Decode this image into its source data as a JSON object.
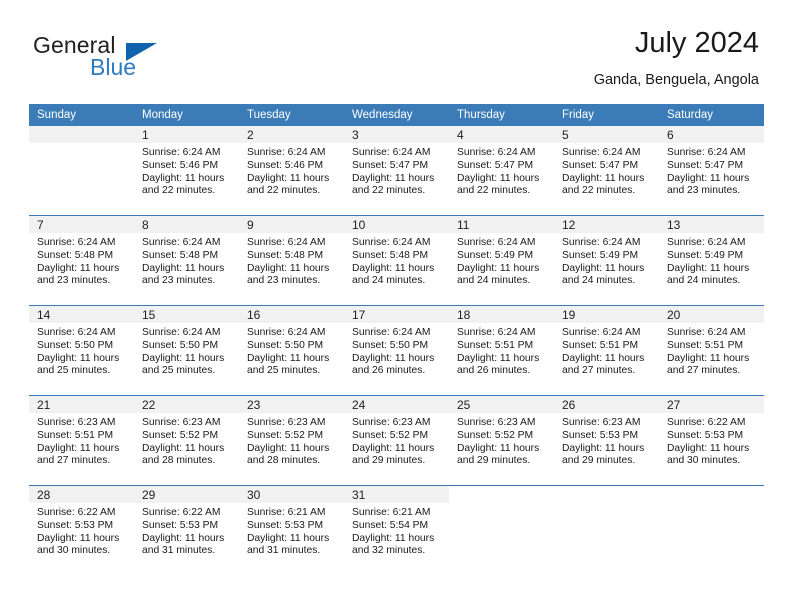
{
  "brand": {
    "name_top": "General",
    "name_bottom": "Blue",
    "accent_color": "#0f62ac",
    "blue_text_color": "#2b7cc4",
    "triangle_icon": "brand-triangle-icon"
  },
  "header": {
    "title": "July 2024",
    "subtitle": "Ganda, Benguela, Angola"
  },
  "calendar": {
    "header_bg": "#3b7cb8",
    "daynum_bg": "#f1f1f1",
    "weekdays": [
      "Sunday",
      "Monday",
      "Tuesday",
      "Wednesday",
      "Thursday",
      "Friday",
      "Saturday"
    ],
    "weeks": [
      [
        {
          "day": "",
          "sunrise": "",
          "sunset": "",
          "daylight": "",
          "daylight2": "",
          "empty": true
        },
        {
          "day": "1",
          "sunrise": "Sunrise: 6:24 AM",
          "sunset": "Sunset: 5:46 PM",
          "daylight": "Daylight: 11 hours",
          "daylight2": "and 22 minutes."
        },
        {
          "day": "2",
          "sunrise": "Sunrise: 6:24 AM",
          "sunset": "Sunset: 5:46 PM",
          "daylight": "Daylight: 11 hours",
          "daylight2": "and 22 minutes."
        },
        {
          "day": "3",
          "sunrise": "Sunrise: 6:24 AM",
          "sunset": "Sunset: 5:47 PM",
          "daylight": "Daylight: 11 hours",
          "daylight2": "and 22 minutes."
        },
        {
          "day": "4",
          "sunrise": "Sunrise: 6:24 AM",
          "sunset": "Sunset: 5:47 PM",
          "daylight": "Daylight: 11 hours",
          "daylight2": "and 22 minutes."
        },
        {
          "day": "5",
          "sunrise": "Sunrise: 6:24 AM",
          "sunset": "Sunset: 5:47 PM",
          "daylight": "Daylight: 11 hours",
          "daylight2": "and 22 minutes."
        },
        {
          "day": "6",
          "sunrise": "Sunrise: 6:24 AM",
          "sunset": "Sunset: 5:47 PM",
          "daylight": "Daylight: 11 hours",
          "daylight2": "and 23 minutes."
        }
      ],
      [
        {
          "day": "7",
          "sunrise": "Sunrise: 6:24 AM",
          "sunset": "Sunset: 5:48 PM",
          "daylight": "Daylight: 11 hours",
          "daylight2": "and 23 minutes."
        },
        {
          "day": "8",
          "sunrise": "Sunrise: 6:24 AM",
          "sunset": "Sunset: 5:48 PM",
          "daylight": "Daylight: 11 hours",
          "daylight2": "and 23 minutes."
        },
        {
          "day": "9",
          "sunrise": "Sunrise: 6:24 AM",
          "sunset": "Sunset: 5:48 PM",
          "daylight": "Daylight: 11 hours",
          "daylight2": "and 23 minutes."
        },
        {
          "day": "10",
          "sunrise": "Sunrise: 6:24 AM",
          "sunset": "Sunset: 5:48 PM",
          "daylight": "Daylight: 11 hours",
          "daylight2": "and 24 minutes."
        },
        {
          "day": "11",
          "sunrise": "Sunrise: 6:24 AM",
          "sunset": "Sunset: 5:49 PM",
          "daylight": "Daylight: 11 hours",
          "daylight2": "and 24 minutes."
        },
        {
          "day": "12",
          "sunrise": "Sunrise: 6:24 AM",
          "sunset": "Sunset: 5:49 PM",
          "daylight": "Daylight: 11 hours",
          "daylight2": "and 24 minutes."
        },
        {
          "day": "13",
          "sunrise": "Sunrise: 6:24 AM",
          "sunset": "Sunset: 5:49 PM",
          "daylight": "Daylight: 11 hours",
          "daylight2": "and 24 minutes."
        }
      ],
      [
        {
          "day": "14",
          "sunrise": "Sunrise: 6:24 AM",
          "sunset": "Sunset: 5:50 PM",
          "daylight": "Daylight: 11 hours",
          "daylight2": "and 25 minutes."
        },
        {
          "day": "15",
          "sunrise": "Sunrise: 6:24 AM",
          "sunset": "Sunset: 5:50 PM",
          "daylight": "Daylight: 11 hours",
          "daylight2": "and 25 minutes."
        },
        {
          "day": "16",
          "sunrise": "Sunrise: 6:24 AM",
          "sunset": "Sunset: 5:50 PM",
          "daylight": "Daylight: 11 hours",
          "daylight2": "and 25 minutes."
        },
        {
          "day": "17",
          "sunrise": "Sunrise: 6:24 AM",
          "sunset": "Sunset: 5:50 PM",
          "daylight": "Daylight: 11 hours",
          "daylight2": "and 26 minutes."
        },
        {
          "day": "18",
          "sunrise": "Sunrise: 6:24 AM",
          "sunset": "Sunset: 5:51 PM",
          "daylight": "Daylight: 11 hours",
          "daylight2": "and 26 minutes."
        },
        {
          "day": "19",
          "sunrise": "Sunrise: 6:24 AM",
          "sunset": "Sunset: 5:51 PM",
          "daylight": "Daylight: 11 hours",
          "daylight2": "and 27 minutes."
        },
        {
          "day": "20",
          "sunrise": "Sunrise: 6:24 AM",
          "sunset": "Sunset: 5:51 PM",
          "daylight": "Daylight: 11 hours",
          "daylight2": "and 27 minutes."
        }
      ],
      [
        {
          "day": "21",
          "sunrise": "Sunrise: 6:23 AM",
          "sunset": "Sunset: 5:51 PM",
          "daylight": "Daylight: 11 hours",
          "daylight2": "and 27 minutes."
        },
        {
          "day": "22",
          "sunrise": "Sunrise: 6:23 AM",
          "sunset": "Sunset: 5:52 PM",
          "daylight": "Daylight: 11 hours",
          "daylight2": "and 28 minutes."
        },
        {
          "day": "23",
          "sunrise": "Sunrise: 6:23 AM",
          "sunset": "Sunset: 5:52 PM",
          "daylight": "Daylight: 11 hours",
          "daylight2": "and 28 minutes."
        },
        {
          "day": "24",
          "sunrise": "Sunrise: 6:23 AM",
          "sunset": "Sunset: 5:52 PM",
          "daylight": "Daylight: 11 hours",
          "daylight2": "and 29 minutes."
        },
        {
          "day": "25",
          "sunrise": "Sunrise: 6:23 AM",
          "sunset": "Sunset: 5:52 PM",
          "daylight": "Daylight: 11 hours",
          "daylight2": "and 29 minutes."
        },
        {
          "day": "26",
          "sunrise": "Sunrise: 6:23 AM",
          "sunset": "Sunset: 5:53 PM",
          "daylight": "Daylight: 11 hours",
          "daylight2": "and 29 minutes."
        },
        {
          "day": "27",
          "sunrise": "Sunrise: 6:22 AM",
          "sunset": "Sunset: 5:53 PM",
          "daylight": "Daylight: 11 hours",
          "daylight2": "and 30 minutes."
        }
      ],
      [
        {
          "day": "28",
          "sunrise": "Sunrise: 6:22 AM",
          "sunset": "Sunset: 5:53 PM",
          "daylight": "Daylight: 11 hours",
          "daylight2": "and 30 minutes."
        },
        {
          "day": "29",
          "sunrise": "Sunrise: 6:22 AM",
          "sunset": "Sunset: 5:53 PM",
          "daylight": "Daylight: 11 hours",
          "daylight2": "and 31 minutes."
        },
        {
          "day": "30",
          "sunrise": "Sunrise: 6:21 AM",
          "sunset": "Sunset: 5:53 PM",
          "daylight": "Daylight: 11 hours",
          "daylight2": "and 31 minutes."
        },
        {
          "day": "31",
          "sunrise": "Sunrise: 6:21 AM",
          "sunset": "Sunset: 5:54 PM",
          "daylight": "Daylight: 11 hours",
          "daylight2": "and 32 minutes."
        },
        {
          "day": "",
          "sunrise": "",
          "sunset": "",
          "daylight": "",
          "daylight2": "",
          "blank": true
        },
        {
          "day": "",
          "sunrise": "",
          "sunset": "",
          "daylight": "",
          "daylight2": "",
          "blank": true
        },
        {
          "day": "",
          "sunrise": "",
          "sunset": "",
          "daylight": "",
          "daylight2": "",
          "blank": true
        }
      ]
    ]
  }
}
